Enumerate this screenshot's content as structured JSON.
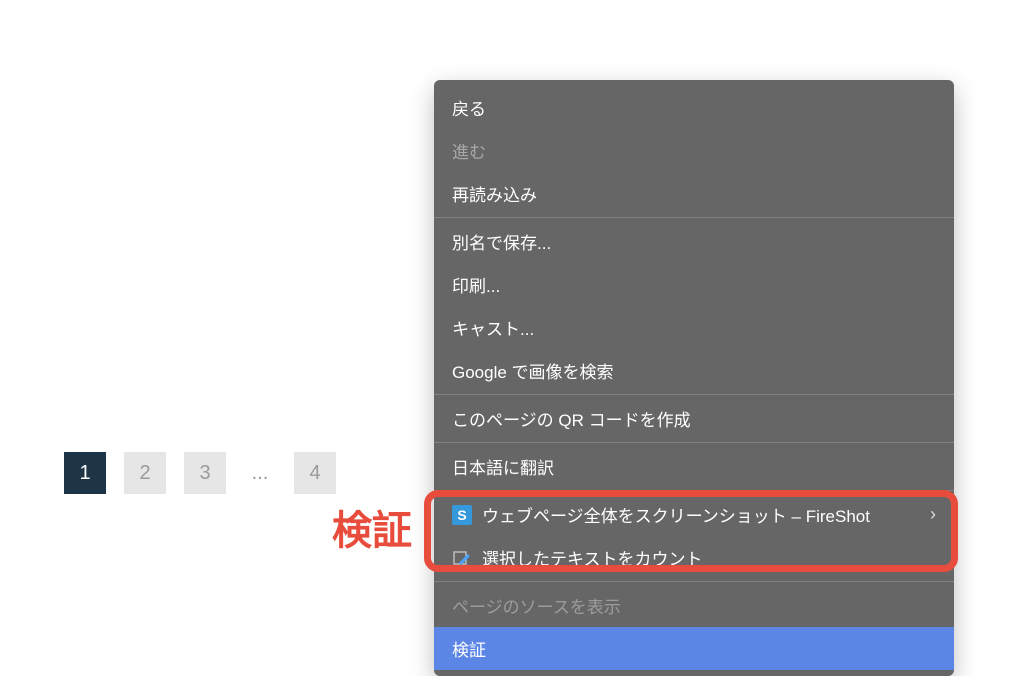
{
  "pagination": {
    "pages": [
      "1",
      "2",
      "3",
      "4"
    ],
    "ellipsis": "...",
    "active": "1"
  },
  "context_menu": {
    "back": "戻る",
    "forward": "進む",
    "reload": "再読み込み",
    "save_as": "別名で保存...",
    "print": "印刷...",
    "cast": "キャスト...",
    "search_image": "Google で画像を検索",
    "qr_code": "このページの QR コードを作成",
    "translate": "日本語に翻訳",
    "fireshot": "ウェブページ全体をスクリーンショット – FireShot",
    "text_count": "選択したテキストをカウント",
    "view_source": "ページのソースを表示",
    "inspect": "検証"
  },
  "highlight": {
    "label": "検証"
  }
}
